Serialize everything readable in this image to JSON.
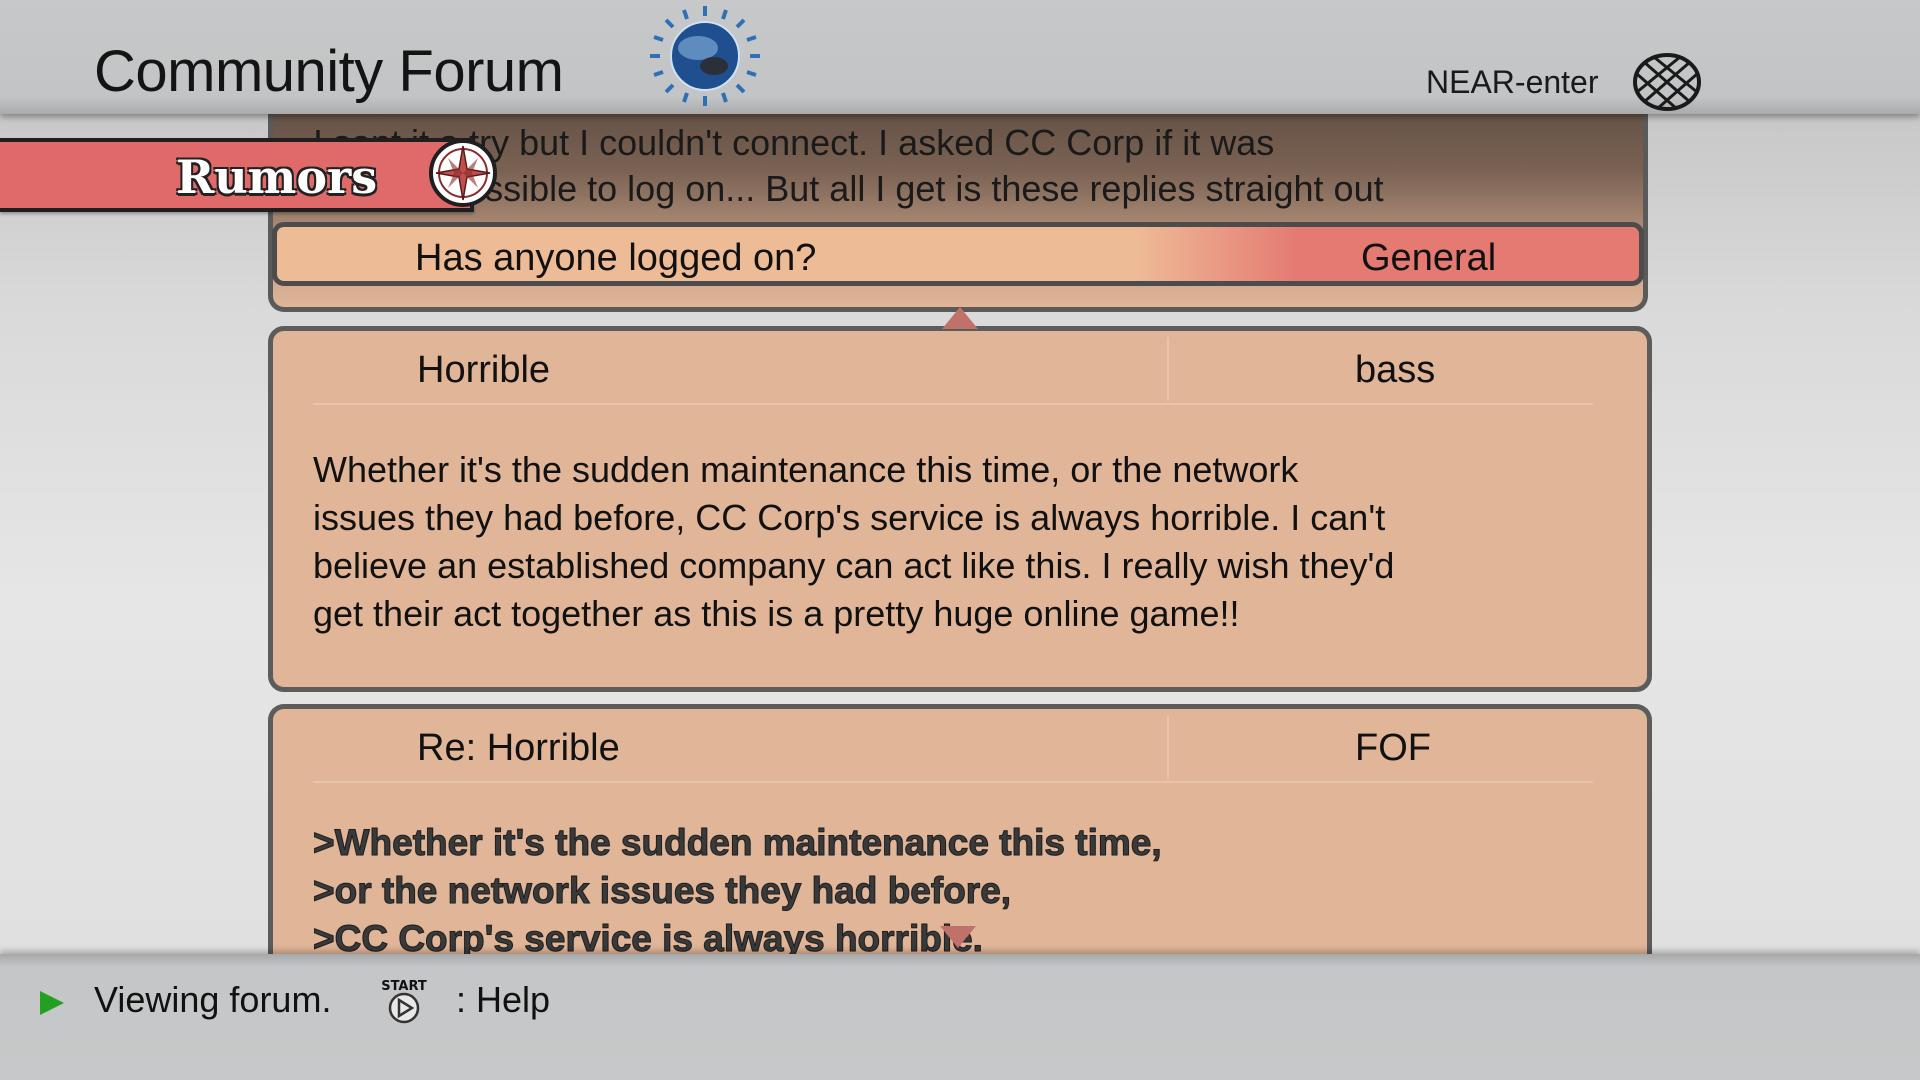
{
  "header": {
    "title": "Community Forum",
    "logo_icon": "globe-logo-icon",
    "user_name": "NEAR-enter",
    "network_icon": "wireframe-globe-icon"
  },
  "category": {
    "label": "Rumors",
    "icon": "compass-icon",
    "color": "#e06a6a"
  },
  "thread": {
    "snippet_lines": [
      "I sent it a try but I couldn't connect. I asked CC Corp if it was",
      "actually possible to log on... But all I get is these replies straight out"
    ],
    "title": "Has anyone logged on?",
    "category": "General"
  },
  "posts": [
    {
      "title": "Horrible",
      "author": "bass",
      "body_lines": [
        "Whether it's the sudden maintenance this time, or the network",
        "issues they had before, CC Corp's service is always horrible. I can't",
        "believe an established company can act like this. I really wish they'd",
        "get their act together as this is a pretty huge online game!!"
      ]
    },
    {
      "title": "Re: Horrible",
      "author": "FOF",
      "quote_lines": [
        ">Whether it's the sudden maintenance this time,",
        ">or the network issues they had before,",
        ">CC Corp's service is always horrible."
      ]
    }
  ],
  "footer": {
    "status": "Viewing forum.",
    "start_label": "START",
    "help": ": Help",
    "status_icon_color": "#22a022"
  },
  "colors": {
    "post_bg": "#e0b598",
    "selected_row": "#eebb97",
    "category_tag": "#e47a72"
  }
}
